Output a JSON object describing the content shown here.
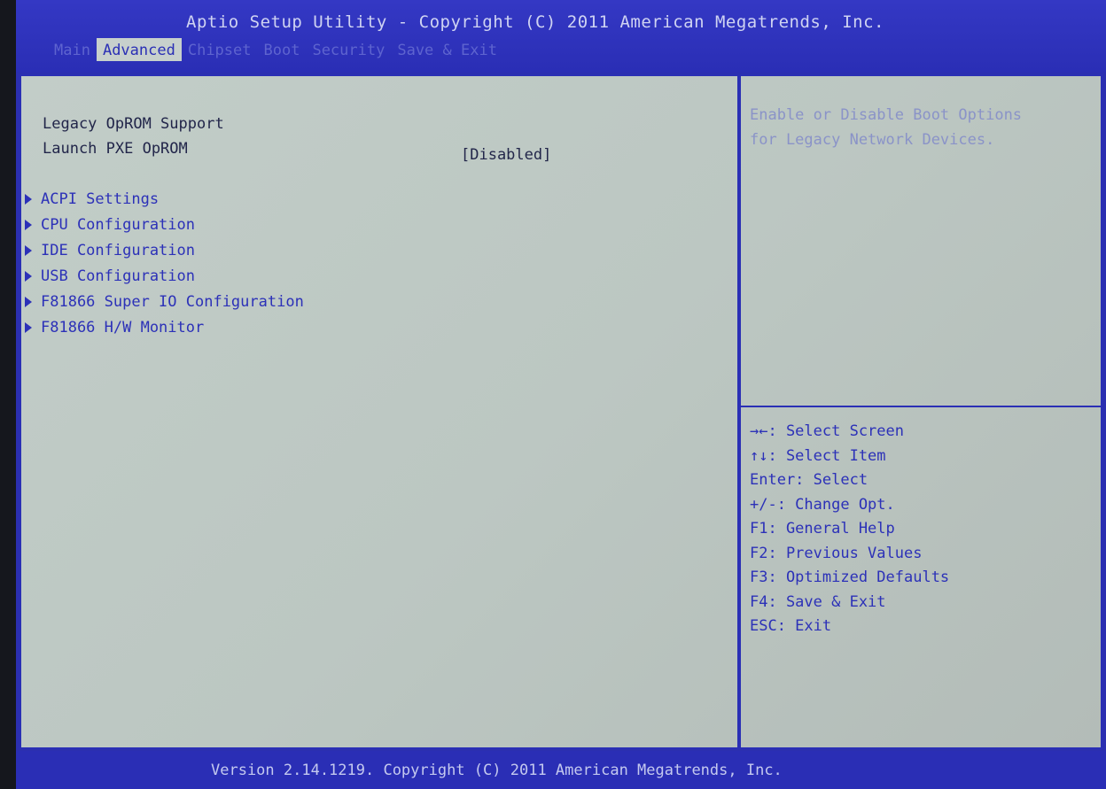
{
  "header": {
    "title": "Aptio Setup Utility - Copyright (C) 2011 American Megatrends, Inc.",
    "tabs": [
      {
        "label": "Main"
      },
      {
        "label": "Advanced"
      },
      {
        "label": "Chipset"
      },
      {
        "label": "Boot"
      },
      {
        "label": "Security"
      },
      {
        "label": "Save & Exit"
      }
    ],
    "active_tab": "Advanced"
  },
  "main": {
    "section_title": "Legacy OpROM Support",
    "settings": [
      {
        "label": "Launch PXE OpROM",
        "value": "[Disabled]"
      }
    ],
    "submenus": [
      {
        "label": "ACPI Settings"
      },
      {
        "label": "CPU Configuration"
      },
      {
        "label": "IDE Configuration"
      },
      {
        "label": "USB Configuration"
      },
      {
        "label": "F81866 Super IO Configuration"
      },
      {
        "label": "F81866 H/W Monitor"
      }
    ]
  },
  "help": {
    "lines": [
      "Enable or Disable Boot Options",
      "for Legacy Network Devices."
    ]
  },
  "keys": [
    "→←: Select Screen",
    "↑↓: Select Item",
    "Enter: Select",
    "+/-: Change Opt.",
    "F1: General Help",
    "F2: Previous Values",
    "F3: Optimized Defaults",
    "F4: Save & Exit",
    "ESC: Exit"
  ],
  "footer": {
    "text": "Version 2.14.1219. Copyright (C) 2011 American Megatrends, Inc."
  },
  "colors": {
    "background_blue": "#2b2fb0",
    "panel_gray": "#c2cdc8",
    "text_blue": "#2c31b8"
  }
}
